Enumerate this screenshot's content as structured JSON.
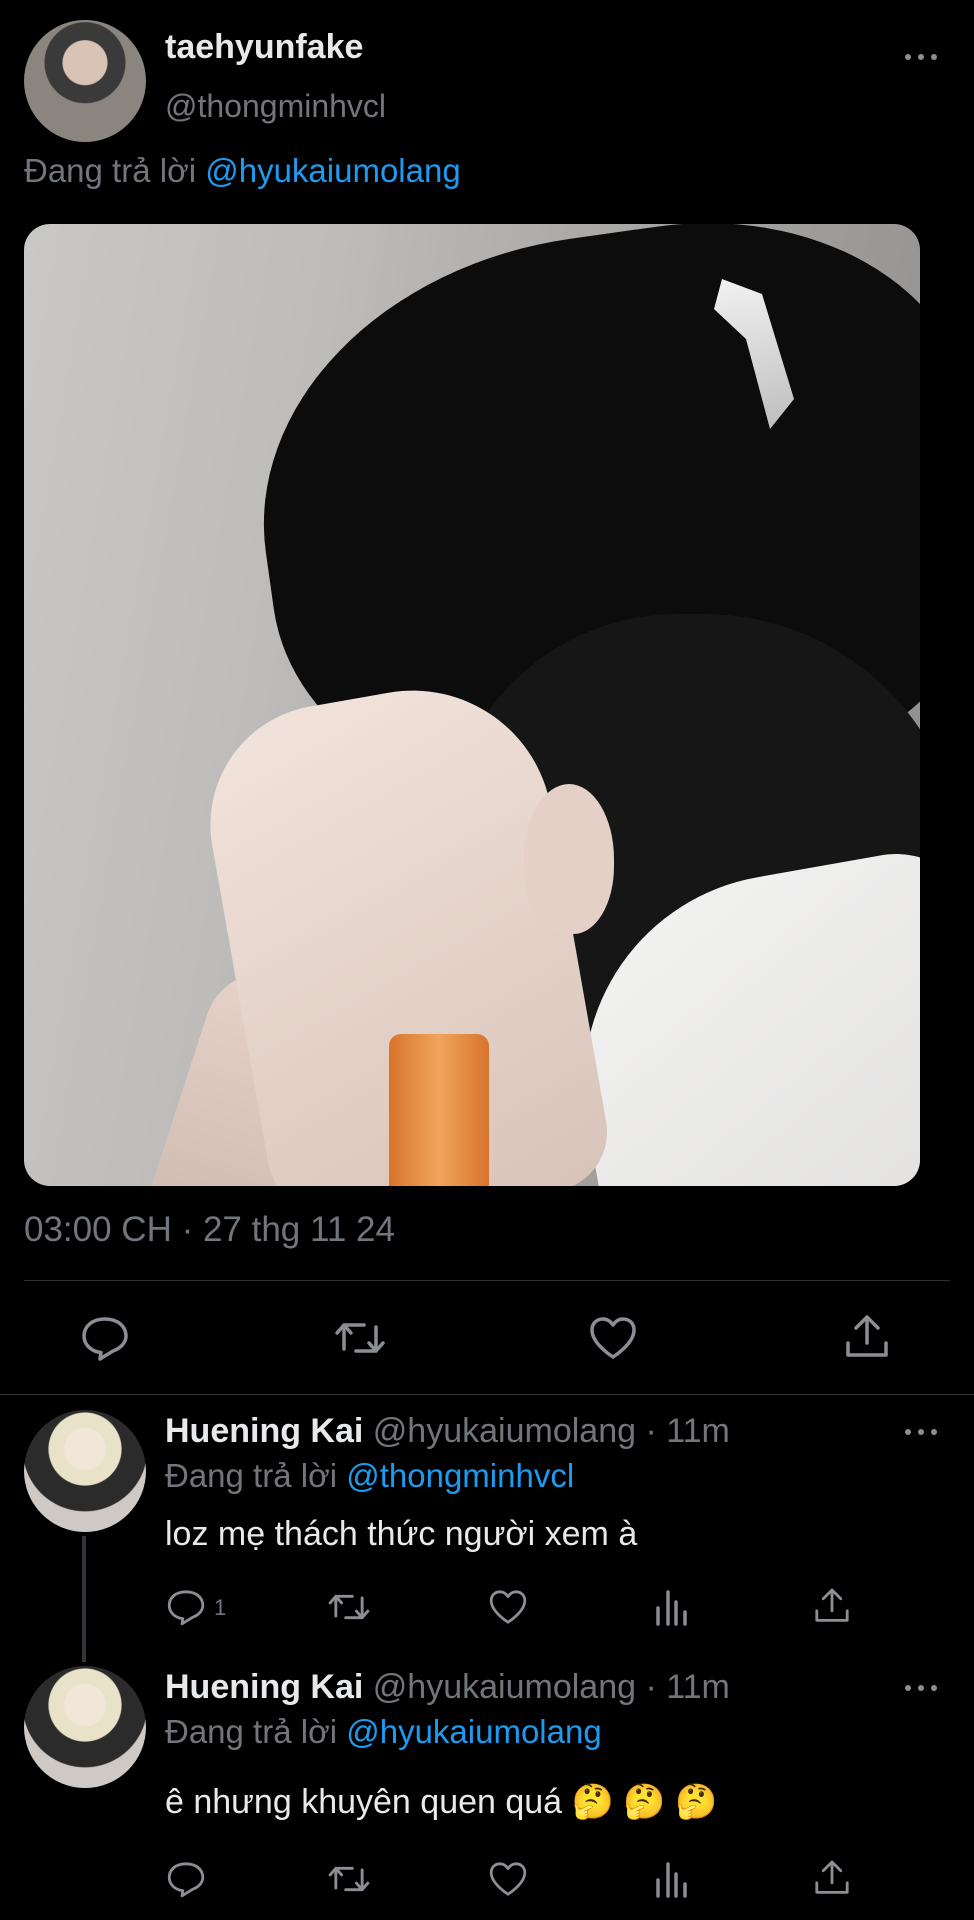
{
  "main_tweet": {
    "display_name": "taehyunfake",
    "handle": "@thongminhvcl",
    "replying_prefix": "Đang trả lời",
    "replying_to": "@hyukaiumolang",
    "timestamp": "03:00 CH · 27 thg 11 24",
    "more_icon": "more-horizontal-icon"
  },
  "actions_icons": [
    "reply-icon",
    "retweet-icon",
    "like-icon",
    "share-icon"
  ],
  "replies": [
    {
      "display_name": "Huening Kai",
      "handle": "@hyukaiumolang",
      "time": "· 11m",
      "replying_prefix": "Đang trả lời",
      "replying_to": "@thongminhvcl",
      "text": "loz mẹ thách thức người xem à",
      "reply_count": "1"
    },
    {
      "display_name": "Huening Kai",
      "handle": "@hyukaiumolang",
      "time": "· 11m",
      "replying_prefix": "Đang trả lời",
      "replying_to": "@hyukaiumolang",
      "text": "ê nhưng khuyên quen quá",
      "emojis": "🤔 🤔 🤔",
      "reply_count": ""
    }
  ],
  "colors": {
    "background": "#000000",
    "link": "#1d9bf0",
    "muted": "#71767b",
    "text": "#e7e9ea"
  }
}
